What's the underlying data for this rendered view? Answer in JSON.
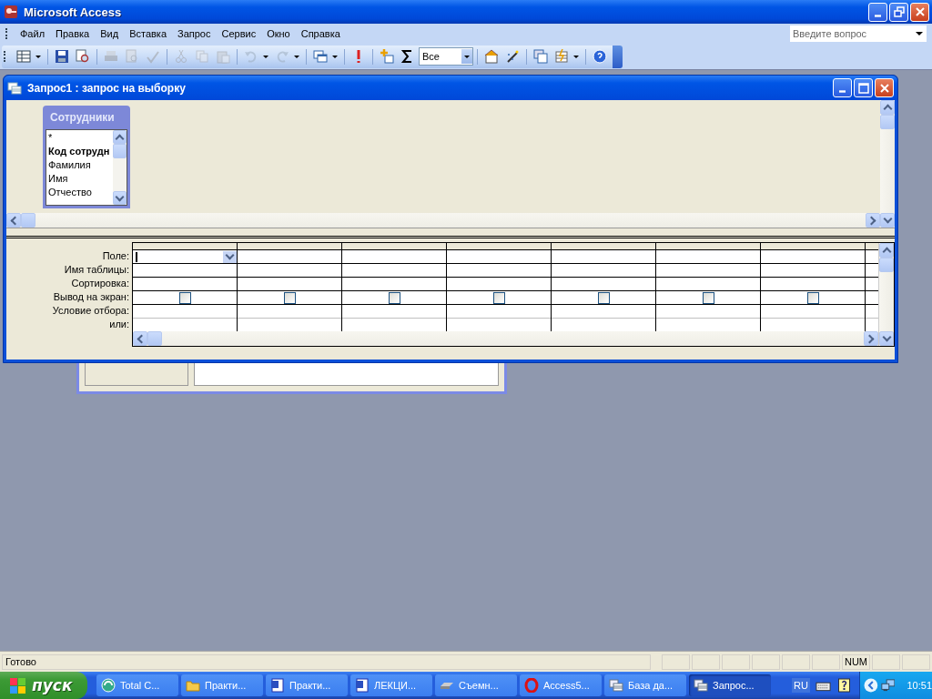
{
  "window": {
    "title": "Microsoft Access"
  },
  "menu": [
    "Файл",
    "Правка",
    "Вид",
    "Вставка",
    "Запрос",
    "Сервис",
    "Окно",
    "Справка"
  ],
  "help_search": {
    "placeholder": "Введите вопрос"
  },
  "toolbar": {
    "buttons": [
      {
        "disabled": false
      },
      {
        "disabled": false
      },
      {
        "disabled": false
      },
      {
        "disabled": true
      },
      {
        "disabled": true
      },
      {
        "disabled": true
      },
      {
        "disabled": true
      },
      {
        "disabled": true
      },
      {
        "disabled": true
      },
      {
        "disabled": true
      },
      {
        "disabled": true
      },
      {
        "disabled": false
      },
      {
        "disabled": false
      },
      {
        "disabled": false
      },
      {
        "disabled": false
      }
    ],
    "top_values": "Все",
    "after_combo": [
      {
        "disabled": false
      },
      {
        "disabled": false
      },
      {
        "disabled": false
      },
      {
        "disabled": false
      },
      {
        "disabled": false
      }
    ]
  },
  "query_window": {
    "title": "Запрос1 : запрос на выборку",
    "table": {
      "title": "Сотрудники",
      "fields": [
        {
          "name": "*",
          "primary_key": false
        },
        {
          "name": "Код сотрудн",
          "primary_key": true
        },
        {
          "name": "Фамилия",
          "primary_key": false
        },
        {
          "name": "Имя",
          "primary_key": false
        },
        {
          "name": "Отчество",
          "primary_key": false
        }
      ]
    },
    "row_labels": [
      "Поле:",
      "Имя таблицы:",
      "Сортировка:",
      "Вывод на экран:",
      "Условие отбора:",
      "или:"
    ],
    "columns": [
      {
        "selected": true,
        "show": false
      },
      {
        "selected": false,
        "show": false
      },
      {
        "selected": false,
        "show": false
      },
      {
        "selected": false,
        "show": false
      },
      {
        "selected": false,
        "show": false
      },
      {
        "selected": false,
        "show": false
      },
      {
        "selected": false,
        "show": false
      }
    ]
  },
  "status_bar": {
    "text": "Готово",
    "num": "NUM"
  },
  "taskbar": {
    "start": "пуск",
    "items": [
      {
        "label": "Total C...",
        "selected": false
      },
      {
        "label": "Практи...",
        "selected": false
      },
      {
        "label": "Практи...",
        "selected": false
      },
      {
        "label": "ЛЕКЦИ...",
        "selected": false
      },
      {
        "label": "Съемн...",
        "selected": false
      },
      {
        "label": "Access5...",
        "selected": false
      },
      {
        "label": "База да...",
        "selected": false
      },
      {
        "label": "Запрос...",
        "selected": true
      }
    ],
    "language": "RU",
    "time": "10:51"
  }
}
